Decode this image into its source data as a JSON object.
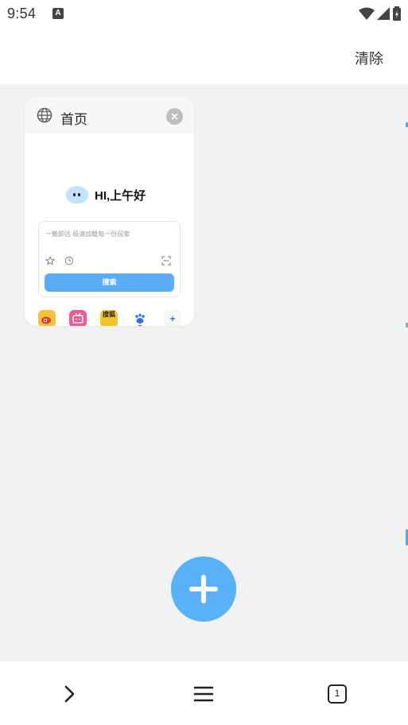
{
  "status_bar": {
    "time": "9:54",
    "notification_icon": "A"
  },
  "top_bar": {
    "clear_label": "清除"
  },
  "tab": {
    "title": "首页",
    "icon": "globe-icon",
    "preview": {
      "greeting": "HI,上午好",
      "search_placeholder": "一触即达 极速加载每一份探索",
      "search_button": "搜索",
      "quick_links": [
        {
          "name": "weibo-icon",
          "text": "",
          "color": "#f5c33b"
        },
        {
          "name": "bilibili-icon",
          "text": "",
          "color": "#ee5a8a"
        },
        {
          "name": "sohu-icon",
          "text": "搜狐",
          "color": "#f6c32a"
        },
        {
          "name": "baidu-icon",
          "text": "",
          "color": "#ffffff"
        },
        {
          "name": "add-icon",
          "text": "+",
          "color": "#f5f6f8"
        }
      ]
    }
  },
  "fab": {
    "icon": "plus-icon"
  },
  "nav_bar": {
    "tab_count": "1"
  },
  "colors": {
    "accent": "#58b1f9",
    "background": "#f1f2f4"
  }
}
